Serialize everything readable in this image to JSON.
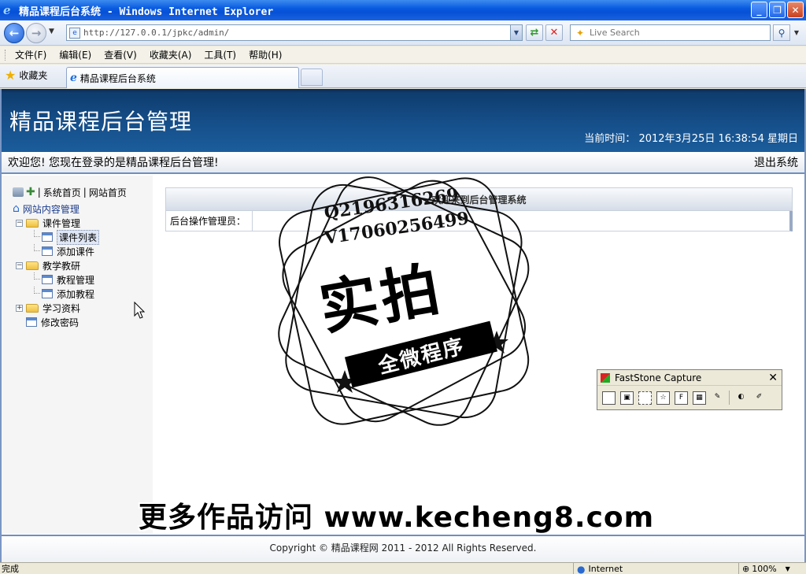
{
  "window": {
    "title": "精品课程后台系统 - Windows Internet Explorer",
    "minimize": "_",
    "maximize": "❐",
    "close": "✕"
  },
  "addressbar": {
    "url": "http://127.0.0.1/jpkc/admin/",
    "search_placeholder": "Live Search"
  },
  "menubar": {
    "items": [
      "文件(F)",
      "编辑(E)",
      "查看(V)",
      "收藏夹(A)",
      "工具(T)",
      "帮助(H)"
    ]
  },
  "tabbar": {
    "favorites_label": "收藏夹",
    "active_tab": "精品课程后台系统"
  },
  "site": {
    "title": "精品课程后台管理",
    "time_label": "当前时间：",
    "time_value": "2012年3月25日 16:38:54 星期日",
    "welcome": "欢迎您! 您现在登录的是精品课程后台管理!",
    "logout": "退出系统",
    "footer": "Copyright © 精品课程网  2011 - 2012 All Rights Reserved."
  },
  "sidebar": {
    "link_system_home": "系统首页",
    "link_site_home": "网站首页",
    "sep": "|",
    "root": "网站内容管理",
    "nodes": {
      "courseware": "课件管理",
      "courseware_list": "课件列表",
      "add_courseware": "添加课件",
      "teaching": "教学教研",
      "tutorial_manage": "教程管理",
      "add_tutorial": "添加教程",
      "materials": "学习资料",
      "change_password": "修改密码"
    }
  },
  "content": {
    "heading": "欢迎来到后台管理系统",
    "admin_label": "后台操作管理员："
  },
  "watermark": {
    "qq": "Q2196316269",
    "wechat": "V17060256499",
    "big": "实拍",
    "ribbon": "全微程序",
    "promo": "更多作品访问 www.kecheng8.com"
  },
  "faststone": {
    "title": "FastStone Capture",
    "close": "✕"
  },
  "statusbar": {
    "status": "完成",
    "zone": "Internet",
    "zoom": "100%"
  },
  "colors": {
    "header_dark": "#0d3a6a",
    "header_light": "#1b5d9c",
    "accent_border": "#6d8fbf"
  }
}
